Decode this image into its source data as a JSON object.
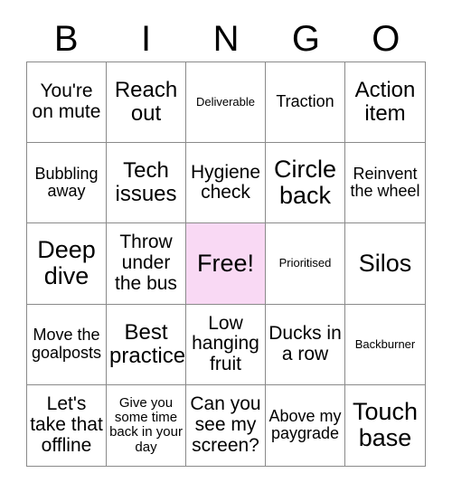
{
  "card": {
    "title": "BINGO",
    "header_letters": [
      "B",
      "I",
      "N",
      "G",
      "O"
    ],
    "free_space_color": "#f9d9f4",
    "border_color": "#8a8a8a",
    "text_color": "#000000",
    "background_color": "#ffffff",
    "rows": 5,
    "columns": 5,
    "cells": [
      {
        "text": "You're on mute",
        "size": "lg",
        "free": false
      },
      {
        "text": "Reach out",
        "size": "xl",
        "free": false
      },
      {
        "text": "Deliverable",
        "size": "xs",
        "free": false
      },
      {
        "text": "Traction",
        "size": "md",
        "free": false
      },
      {
        "text": "Action item",
        "size": "xl",
        "free": false
      },
      {
        "text": "Bubbling away",
        "size": "md",
        "free": false
      },
      {
        "text": "Tech issues",
        "size": "xl",
        "free": false
      },
      {
        "text": "Hygiene check",
        "size": "lg",
        "free": false
      },
      {
        "text": "Circle back",
        "size": "xxl",
        "free": false
      },
      {
        "text": "Reinvent the wheel",
        "size": "md",
        "free": false
      },
      {
        "text": "Deep dive",
        "size": "xxl",
        "free": false
      },
      {
        "text": "Throw under the bus",
        "size": "lg",
        "free": false
      },
      {
        "text": "Free!",
        "size": "xxl",
        "free": true
      },
      {
        "text": "Prioritised",
        "size": "xs",
        "free": false
      },
      {
        "text": "Silos",
        "size": "xxl",
        "free": false
      },
      {
        "text": "Move the goalposts",
        "size": "md",
        "free": false
      },
      {
        "text": "Best practice",
        "size": "xl",
        "free": false
      },
      {
        "text": "Low hanging fruit",
        "size": "lg",
        "free": false
      },
      {
        "text": "Ducks in a row",
        "size": "lg",
        "free": false
      },
      {
        "text": "Backburner",
        "size": "xs",
        "free": false
      },
      {
        "text": "Let's take that offline",
        "size": "lg",
        "free": false
      },
      {
        "text": "Give you some time back in your day",
        "size": "sm",
        "free": false
      },
      {
        "text": "Can you see my screen?",
        "size": "lg",
        "free": false
      },
      {
        "text": "Above my paygrade",
        "size": "md",
        "free": false
      },
      {
        "text": "Touch base",
        "size": "xxl",
        "free": false
      }
    ]
  }
}
